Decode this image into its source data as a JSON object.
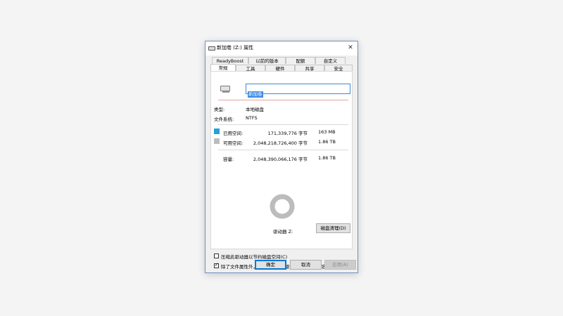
{
  "window": {
    "title": "新加卷 (Z:) 属性",
    "close": "✕"
  },
  "tabs_top": [
    "ReadyBoost",
    "以前的版本",
    "配额",
    "自定义"
  ],
  "tabs_bottom": [
    "常规",
    "工具",
    "硬件",
    "共享",
    "安全"
  ],
  "general": {
    "volume_name": "新加卷",
    "type_label": "类型:",
    "type_value": "本地磁盘",
    "fs_label": "文件系统:",
    "fs_value": "NTFS",
    "used": {
      "label": "已用空间:",
      "bytes": "171,339,776 字节",
      "size": "163 MB",
      "color": "#26a0da"
    },
    "free": {
      "label": "可用空间:",
      "bytes": "2,048,218,726,400 字节",
      "size": "1.86 TB",
      "color": "#bcbcbc"
    },
    "capacity": {
      "label": "容量:",
      "bytes": "2,048,390,066,176 字节",
      "size": "1.86 TB"
    },
    "used_fraction": 8.36e-05,
    "drive_label": "驱动器 Z:",
    "cleanup_button": "磁盘清理(D)",
    "compress_option": "压缩此驱动器以节约磁盘空间(C)",
    "compress_checked": false,
    "index_option": "除了文件属性外，还允许索引此驱动器上文件的内容(I)",
    "index_checked": true
  },
  "buttons": {
    "ok": "确定",
    "cancel": "取消",
    "apply": "应用(A)"
  }
}
